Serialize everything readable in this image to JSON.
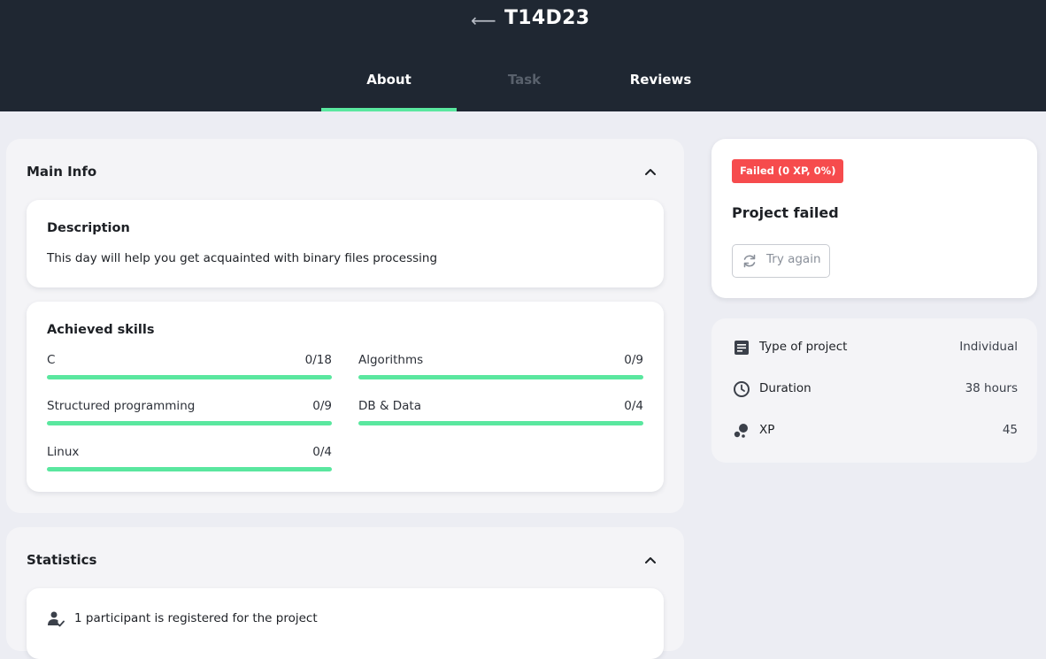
{
  "header": {
    "title": "T14D23",
    "tabs": [
      {
        "label": "About",
        "active": true
      },
      {
        "label": "Task",
        "active": false
      },
      {
        "label": "Reviews",
        "active": false
      }
    ]
  },
  "main_info": {
    "title": "Main Info",
    "description": {
      "heading": "Description",
      "text": "This day will help you get acquainted with binary files processing"
    },
    "skills": {
      "heading": "Achieved skills",
      "items": [
        {
          "name": "C",
          "score": "0/18"
        },
        {
          "name": "Algorithms",
          "score": "0/9"
        },
        {
          "name": "Structured programming",
          "score": "0/9"
        },
        {
          "name": "DB & Data",
          "score": "0/4"
        },
        {
          "name": "Linux",
          "score": "0/4"
        }
      ]
    }
  },
  "statistics": {
    "title": "Statistics",
    "participants_text": "1 participant is registered for the project"
  },
  "status_card": {
    "badge": "Failed (0 XP, 0%)",
    "title": "Project failed",
    "try_again_label": "Try again"
  },
  "project_info": {
    "rows": [
      {
        "icon": "document-icon",
        "key": "Type of project",
        "value": "Individual"
      },
      {
        "icon": "clock-icon",
        "key": "Duration",
        "value": "38 hours"
      },
      {
        "icon": "xp-icon",
        "key": "XP",
        "value": "45"
      }
    ]
  },
  "colors": {
    "header_bg": "#1f2732",
    "accent_green": "#5ae79f",
    "failed_red": "#f64b4d",
    "page_bg": "#ecedf3"
  }
}
